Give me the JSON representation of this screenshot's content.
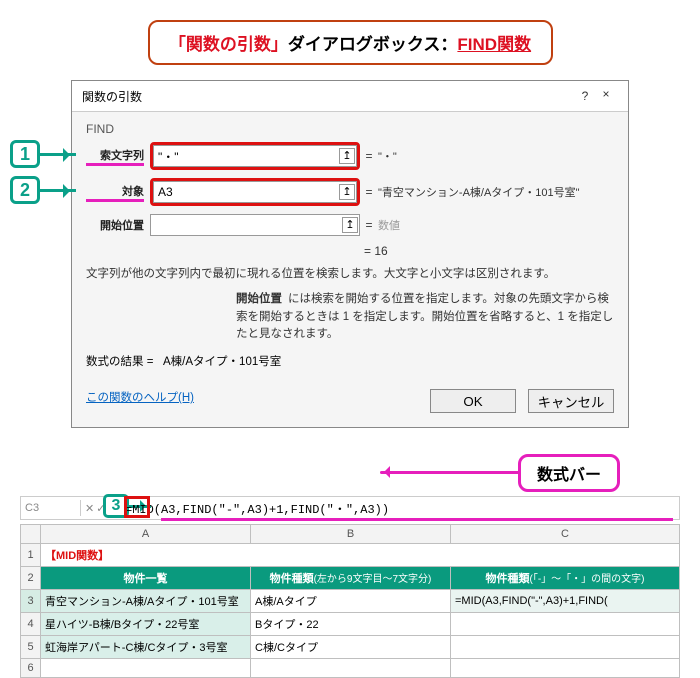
{
  "banner": {
    "q1": "「関数の引数」",
    "mid": "ダイアログボックス：",
    "fn": "FIND関数"
  },
  "dialog": {
    "title": "関数の引数",
    "help": "?",
    "close": "×",
    "fn_name": "FIND",
    "args": {
      "search": {
        "label": "索文字列",
        "value": "\"・\"",
        "result": "\"・\""
      },
      "target": {
        "label": "対象",
        "value": "A3",
        "result": "\"青空マンション-A棟/Aタイプ・101号室\""
      },
      "start": {
        "label": "開始位置",
        "value": "",
        "result": "数値"
      }
    },
    "eq": "=",
    "calc_result": "16",
    "desc": "文字列が他の文字列内で最初に現れる位置を検索します。大文字と小文字は区別されます。",
    "desc2_head": "開始位置",
    "desc2_body": "には検索を開始する位置を指定します。対象の先頭文字から検索を開始するときは 1 を指定します。開始位置を省略すると、1 を指定したと見なされます。",
    "formula_result_label": "数式の結果 =",
    "formula_result_value": "A棟/Aタイプ・101号室",
    "help_link": "この関数のヘルプ(H)",
    "ok": "OK",
    "cancel": "キャンセル"
  },
  "callouts": {
    "n1": "1",
    "n2": "2",
    "n3": "3",
    "fbar": "数式バー"
  },
  "formula_bar": {
    "name": "C3",
    "btns": {
      "cancel": "✕",
      "ok": "✓",
      "fx": "fx"
    },
    "formula": "=MID(A3,FIND(\"-\",A3)+1,FIND(\"・\",A3))"
  },
  "sheet": {
    "cols": {
      "a": "A",
      "b": "B",
      "c": "C"
    },
    "title": "【MID関数】",
    "hdrs": {
      "a": "物件一覧",
      "b": "物件種類",
      "b_sub": "(左から9文字目～7文字分)",
      "c": "物件種類",
      "c_sub": "(「-」～「・」の間の文字)"
    },
    "rows": [
      {
        "n": "3",
        "a": "青空マンション-A棟/Aタイプ・101号室",
        "b": "A棟/Aタイプ",
        "c": "=MID(A3,FIND(\"-\",A3)+1,FIND("
      },
      {
        "n": "4",
        "a": "星ハイツ-B棟/Bタイプ・22号室",
        "b": "Bタイプ・22",
        "c": ""
      },
      {
        "n": "5",
        "a": "虹海岸アパート-C棟/Cタイプ・3号室",
        "b": "C棟/Cタイプ",
        "c": ""
      }
    ],
    "rownums": {
      "r1": "1",
      "r2": "2",
      "r6": "6"
    }
  }
}
